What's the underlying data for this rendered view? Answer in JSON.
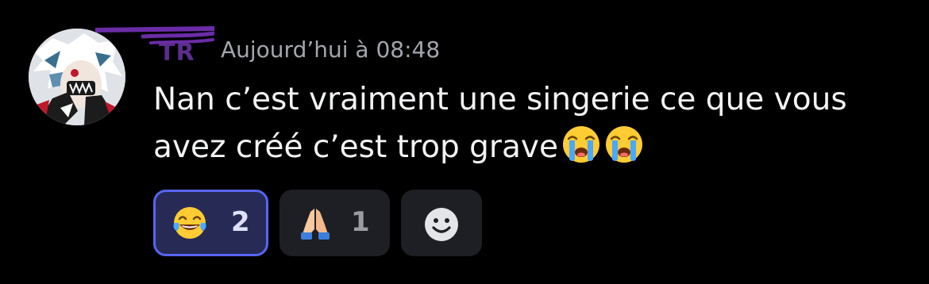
{
  "message": {
    "author": "TR",
    "timestamp": "Aujourd’hui à 08:48",
    "text": "Nan c’est vraiment une singerie ce que vous avez créé c’est trop grave",
    "inline_emojis": [
      "loudly-crying-face",
      "loudly-crying-face"
    ]
  },
  "reactions": [
    {
      "emoji": "face-with-tears-of-joy",
      "count": "2",
      "selected": true
    },
    {
      "emoji": "folded-hands",
      "count": "1",
      "selected": false
    }
  ],
  "add_reaction": {
    "icon": "smiley-add-reaction-icon"
  },
  "colors": {
    "background": "#000000",
    "text": "#f2f3f5",
    "timestamp": "#a3a6ad",
    "username": "#5b2d8e",
    "scribble": "#6a2ca6",
    "reaction_bg": "#1e1f24",
    "reaction_selected_bg": "#262a55",
    "reaction_selected_border": "#5865f2"
  }
}
